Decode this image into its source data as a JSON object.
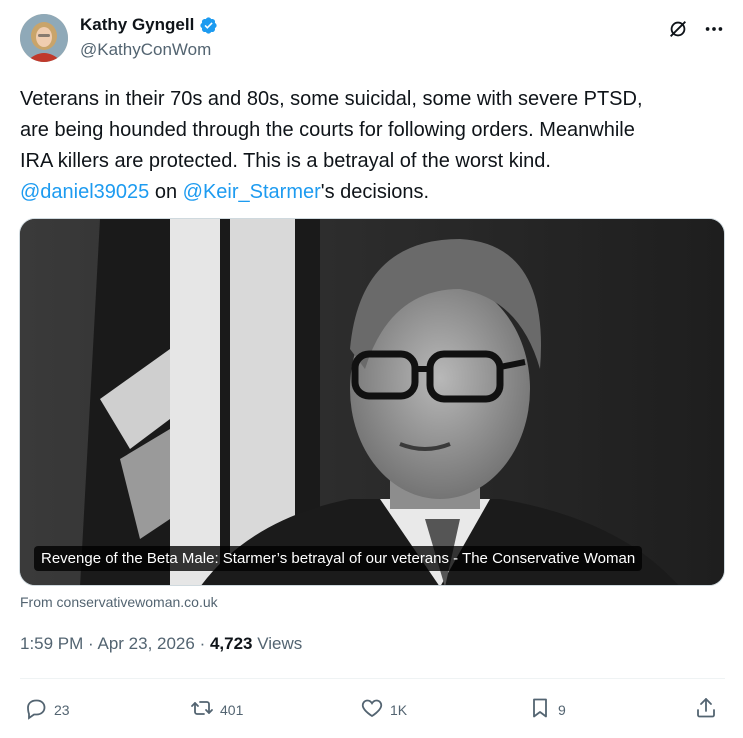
{
  "author": {
    "display_name": "Kathy Gyngell",
    "handle": "@KathyConWom",
    "verified_icon": "verified-badge-icon",
    "avatar": "avatar"
  },
  "tweet": {
    "line1": "Veterans in their 70s and 80s, some suicidal, some with severe PTSD,",
    "line2": "are being hounded through the courts for following orders.  Meanwhile",
    "line3": "IRA killers are protected. This is a betrayal of the worst kind.",
    "mention1": "@daniel39025",
    "mid_text": " on ",
    "mention2": "@Keir_Starmer",
    "end_text": "'s decisions."
  },
  "media": {
    "caption": "Revenge of the Beta Male: Starmer’s betrayal of our veterans - The Conservative Woman"
  },
  "link_source": "From conservativewoman.co.uk",
  "meta": {
    "time": "1:59 PM",
    "sep1": " · ",
    "date": "Apr 23, 2026",
    "sep2": " · ",
    "views_count": "4,723",
    "views_label": " Views"
  },
  "actions": {
    "replies": "23",
    "reposts": "401",
    "likes": "1K",
    "bookmarks": "9"
  },
  "colors": {
    "link": "#1d9bf0",
    "secondary_text": "#536471",
    "primary_text": "#0f1419",
    "verified": "#1d9bf0"
  }
}
